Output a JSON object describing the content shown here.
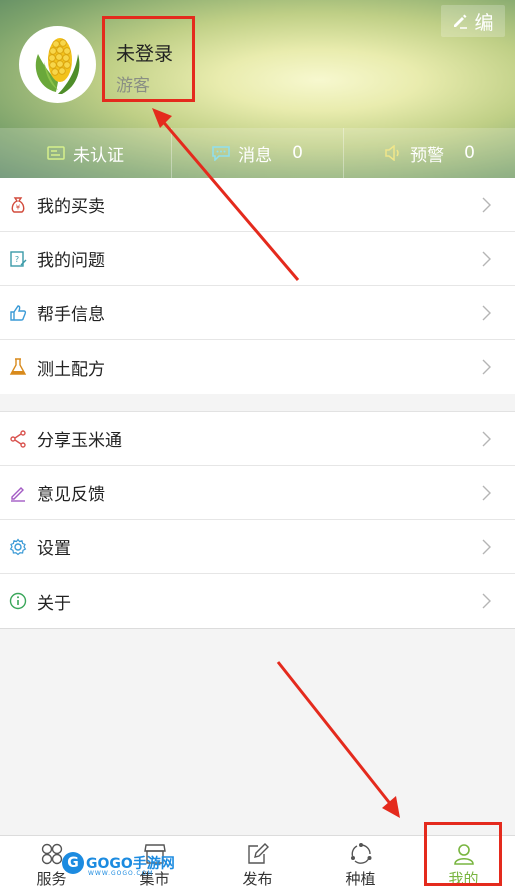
{
  "header": {
    "edit_label": "编",
    "username": "未登录",
    "user_type": "游客"
  },
  "stats": [
    {
      "label": "未认证",
      "count": ""
    },
    {
      "label": "消息",
      "count": "0"
    },
    {
      "label": "预警",
      "count": "0"
    }
  ],
  "menu_group_1": [
    {
      "label": "我的买卖",
      "icon": "money-bag-icon"
    },
    {
      "label": "我的问题",
      "icon": "question-doc-icon"
    },
    {
      "label": "帮手信息",
      "icon": "thumbs-up-icon"
    },
    {
      "label": "测土配方",
      "icon": "flask-icon"
    }
  ],
  "menu_group_2": [
    {
      "label": "分享玉米通",
      "icon": "share-icon"
    },
    {
      "label": "意见反馈",
      "icon": "pen-icon"
    },
    {
      "label": "设置",
      "icon": "gear-icon"
    },
    {
      "label": "关于",
      "icon": "info-icon"
    }
  ],
  "bottom_nav": [
    {
      "label": "服务",
      "icon": "grid-icon"
    },
    {
      "label": "集市",
      "icon": "store-icon"
    },
    {
      "label": "发布",
      "icon": "edit-icon"
    },
    {
      "label": "种植",
      "icon": "cycle-icon"
    },
    {
      "label": "我的",
      "icon": "person-icon"
    }
  ],
  "watermark": {
    "brand": "GOGO手游网",
    "url": "WWW.GOGO.COM"
  },
  "colors": {
    "accent": "#79b540",
    "annotation": "#e42a1d"
  }
}
